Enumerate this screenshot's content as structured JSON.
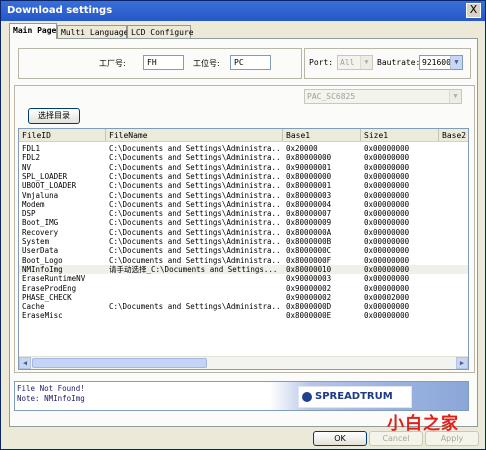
{
  "window": {
    "title": "Download settings",
    "close_label": "X"
  },
  "tabs": [
    {
      "label": "Main Page"
    },
    {
      "label": "Multi Languages"
    },
    {
      "label": "LCD Configure"
    }
  ],
  "factory": {
    "factory_label": "工厂号:",
    "factory_value": "FH",
    "station_label": "工位号:",
    "station_value": "PC"
  },
  "port": {
    "port_label": "Port:",
    "port_value": "All",
    "baud_label": "Bautrate:",
    "baud_value": "921600"
  },
  "product_select": {
    "value": "PAC_SC6825"
  },
  "select_dir_button": "选择目录",
  "table": {
    "columns": [
      "FileID",
      "FileName",
      "Base1",
      "Size1",
      "Base2"
    ],
    "rows": [
      [
        "FDL1",
        "C:\\Documents and Settings\\Administra...",
        "0x20000",
        "0x00000000"
      ],
      [
        "FDL2",
        "C:\\Documents and Settings\\Administra...",
        "0x80000000",
        "0x00000000"
      ],
      [
        "NV",
        "C:\\Documents and Settings\\Administra...",
        "0x90000001",
        "0x00000000"
      ],
      [
        "SPL_LOADER",
        "C:\\Documents and Settings\\Administra...",
        "0x80000000",
        "0x00000000"
      ],
      [
        "UBOOT_LOADER",
        "C:\\Documents and Settings\\Administra...",
        "0x80000001",
        "0x00000000"
      ],
      [
        "Vmjaluna",
        "C:\\Documents and Settings\\Administra...",
        "0x80000003",
        "0x00000000"
      ],
      [
        "Modem",
        "C:\\Documents and Settings\\Administra...",
        "0x80000004",
        "0x00000000"
      ],
      [
        "DSP",
        "C:\\Documents and Settings\\Administra...",
        "0x80000007",
        "0x00000000"
      ],
      [
        "Boot_IMG",
        "C:\\Documents and Settings\\Administra...",
        "0x80000009",
        "0x00000000"
      ],
      [
        "Recovery",
        "C:\\Documents and Settings\\Administra...",
        "0x8000000A",
        "0x00000000"
      ],
      [
        "System",
        "C:\\Documents and Settings\\Administra...",
        "0x8000000B",
        "0x00000000"
      ],
      [
        "UserData",
        "C:\\Documents and Settings\\Administra...",
        "0x8000000C",
        "0x00000000"
      ],
      [
        "Boot_Logo",
        "C:\\Documents and Settings\\Administra...",
        "0x8000000F",
        "0x00000000"
      ],
      [
        "NMInfoImg",
        "请手动选择_C:\\Documents and Settings...",
        "0x80000010",
        "0x00000000"
      ],
      [
        "EraseRuntimeNV",
        "",
        "0x90000003",
        "0x00000000"
      ],
      [
        "EraseProdEng",
        "",
        "0x90000002",
        "0x00000000"
      ],
      [
        "PHASE_CHECK",
        "",
        "0x90000002",
        "0x00002000"
      ],
      [
        "Cache",
        "C:\\Documents and Settings\\Administra...",
        "0x8000000D",
        "0x00000000"
      ],
      [
        "EraseMisc",
        "",
        "0x8000000E",
        "0x00000000"
      ]
    ],
    "selected_row": 13
  },
  "status": {
    "line1": "File Not Found!",
    "line2": "Note: NMInfoImg"
  },
  "logo_text": "SPREADTRUM",
  "buttons": {
    "ok": "OK",
    "cancel": "Cancel",
    "apply": "Apply"
  },
  "watermark": "小白之家",
  "colors": {
    "title_bar": "#2458c8",
    "watermark": "#e0201a"
  }
}
